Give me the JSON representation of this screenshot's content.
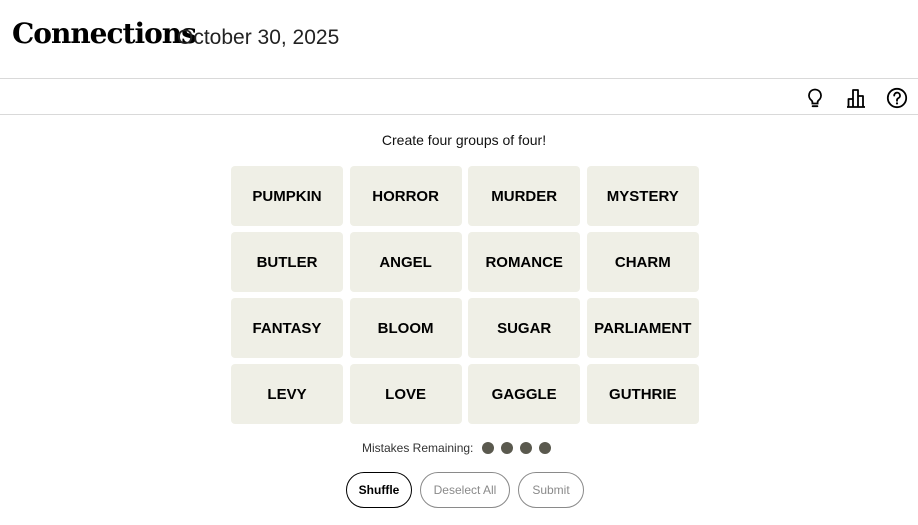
{
  "header": {
    "title": "Connections",
    "date": "October 30, 2025"
  },
  "toolbar": {
    "icons": [
      "hint-lightbulb-icon",
      "stats-bar-chart-icon",
      "help-question-icon"
    ]
  },
  "game": {
    "instructions": "Create four groups of four!",
    "tiles": [
      [
        "PUMPKIN",
        "HORROR",
        "MURDER",
        "MYSTERY"
      ],
      [
        "BUTLER",
        "ANGEL",
        "ROMANCE",
        "CHARM"
      ],
      [
        "FANTASY",
        "BLOOM",
        "SUGAR",
        "PARLIAMENT"
      ],
      [
        "LEVY",
        "LOVE",
        "GAGGLE",
        "GUTHRIE"
      ]
    ],
    "mistakes_label": "Mistakes Remaining:",
    "mistakes_remaining": 4
  },
  "actions": {
    "shuffle": "Shuffle",
    "deselect_all": "Deselect All",
    "submit": "Submit"
  },
  "colors": {
    "tile_background": "#efefe6",
    "mistake_dot": "#5a594e",
    "disabled_button": "#8a8a8a"
  }
}
